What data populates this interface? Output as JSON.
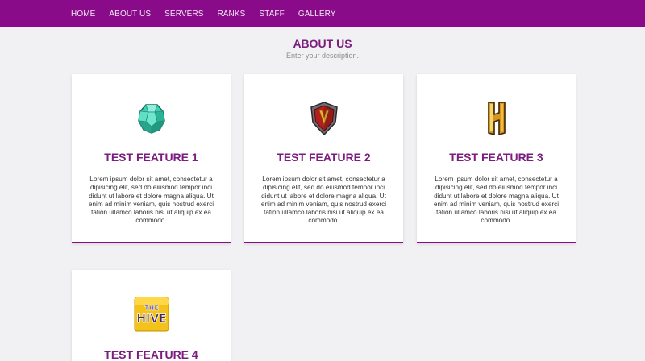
{
  "nav": {
    "items": [
      "HOME",
      "ABOUT US",
      "SERVERS",
      "RANKS",
      "STAFF",
      "GALLERY"
    ]
  },
  "about": {
    "title": "ABOUT US",
    "description": "Enter your description."
  },
  "features": [
    {
      "title": "TEST FEATURE 1",
      "icon": "emerald-gem-icon",
      "text": "Lorem ipsum dolor sit amet, consectetur a dipisicing elit, sed do eiusmod tempor inci didunt ut labore et dolore magna aliqua. Ut enim ad minim veniam, quis nostrud exerci tation ullamco laboris nisi ut aliquip ex ea commodo."
    },
    {
      "title": "TEST FEATURE 2",
      "icon": "shield-logo-icon",
      "text": "Lorem ipsum dolor sit amet, consectetur a dipisicing elit, sed do eiusmod tempor inci didunt ut labore et dolore magna aliqua. Ut enim ad minim veniam, quis nostrud exerci tation ullamco laboris nisi ut aliquip ex ea commodo."
    },
    {
      "title": "TEST FEATURE 3",
      "icon": "hypixel-logo-icon",
      "text": "Lorem ipsum dolor sit amet, consectetur a dipisicing elit, sed do eiusmod tempor inci didunt ut labore et dolore magna aliqua. Ut enim ad minim veniam, quis nostrud exerci tation ullamco laboris nisi ut aliquip ex ea commodo."
    },
    {
      "title": "TEST FEATURE 4",
      "icon": "the-hive-logo-icon",
      "logo_lines": [
        "THE",
        "HIVE"
      ]
    }
  ],
  "colors": {
    "accent": "#8a0b8a",
    "title": "#7b1d7e",
    "background": "#f1f0f2"
  }
}
